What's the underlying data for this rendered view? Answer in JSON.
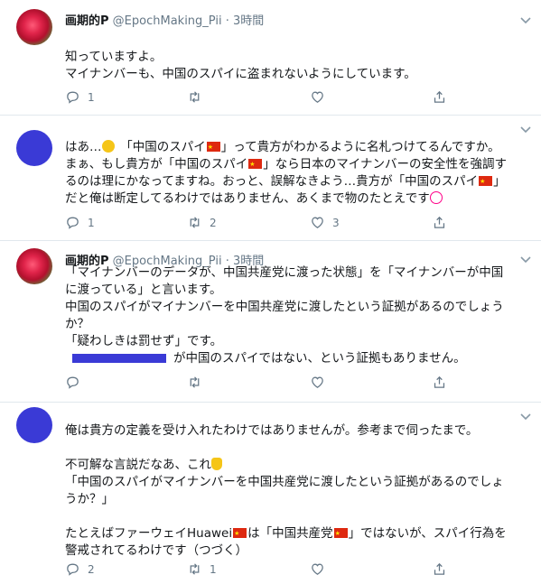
{
  "tweets": [
    {
      "name": "画期的P",
      "handle": "@EpochMaking_Pii · 3時間",
      "lines": [
        "知っていますよ。",
        "マイナンバーも、中国のスパイに盗まれないようにしています。"
      ],
      "reply_count": "1",
      "retweet_count": "",
      "like_count": ""
    },
    {
      "name": "",
      "handle": "",
      "lines": [
        [
          "はあ…",
          "　「中国のスパイ",
          "」って貴方がわかるように名札つけてるんですか。"
        ],
        [
          "まぁ、もし貴方が「中国のスパイ",
          "」なら日本のマイナンバーの安全性を強調す"
        ],
        [
          "るのは理にかなってますね。おっと、誤解なきよう…貴方が「中国のスパイ",
          "」"
        ],
        [
          "だと俺は断定してるわけではありません、あくまで物のたとえです",
          ""
        ]
      ],
      "reply_count": "1",
      "retweet_count": "2",
      "like_count": "3"
    },
    {
      "name": "画期的P",
      "handle": "@EpochMaking_Pii · 3時間",
      "lines": [
        "「マイナンバーのデータが、中国共産党に渡った状態」を「マイナンバーが中国",
        "に渡っている」と言います。",
        "中国のスパイがマイナンバーを中国共産党に渡したという証拠があるのでしょう",
        "か？",
        "「疑わしきは罰せず」です。",
        "が中国のスパイではない、という証拠もありません。"
      ],
      "reply_count": "",
      "retweet_count": "",
      "like_count": ""
    },
    {
      "name": "",
      "handle": "",
      "lines": [
        "俺は貴方の定義を受け入れたわけではありませんが。参考まで伺ったまで。",
        "",
        "不可解な言説だなあ、これ",
        "「中国のスパイがマイナンバーを中国共産党に渡したという証拠があるのでしょ",
        "うか？」",
        "",
        [
          "たとえばファーウェイHuawei",
          "は「中国共産党",
          "」ではないが、スパイ行為を"
        ],
        "警戒されてるわけです（つづく）"
      ],
      "reply_count": "2",
      "retweet_count": "1",
      "like_count": ""
    }
  ],
  "icons": [
    "reply-icon",
    "retweet-icon",
    "like-icon",
    "share-icon",
    "chevron-down-icon",
    "flag-cn-icon",
    "face-emoji-icon",
    "clown-emoji-icon",
    "pointing-down-emoji-icon"
  ],
  "colors": {
    "accent_blue": "#3a3ad6",
    "muted": "#657786",
    "divider": "#e1e8ed"
  }
}
